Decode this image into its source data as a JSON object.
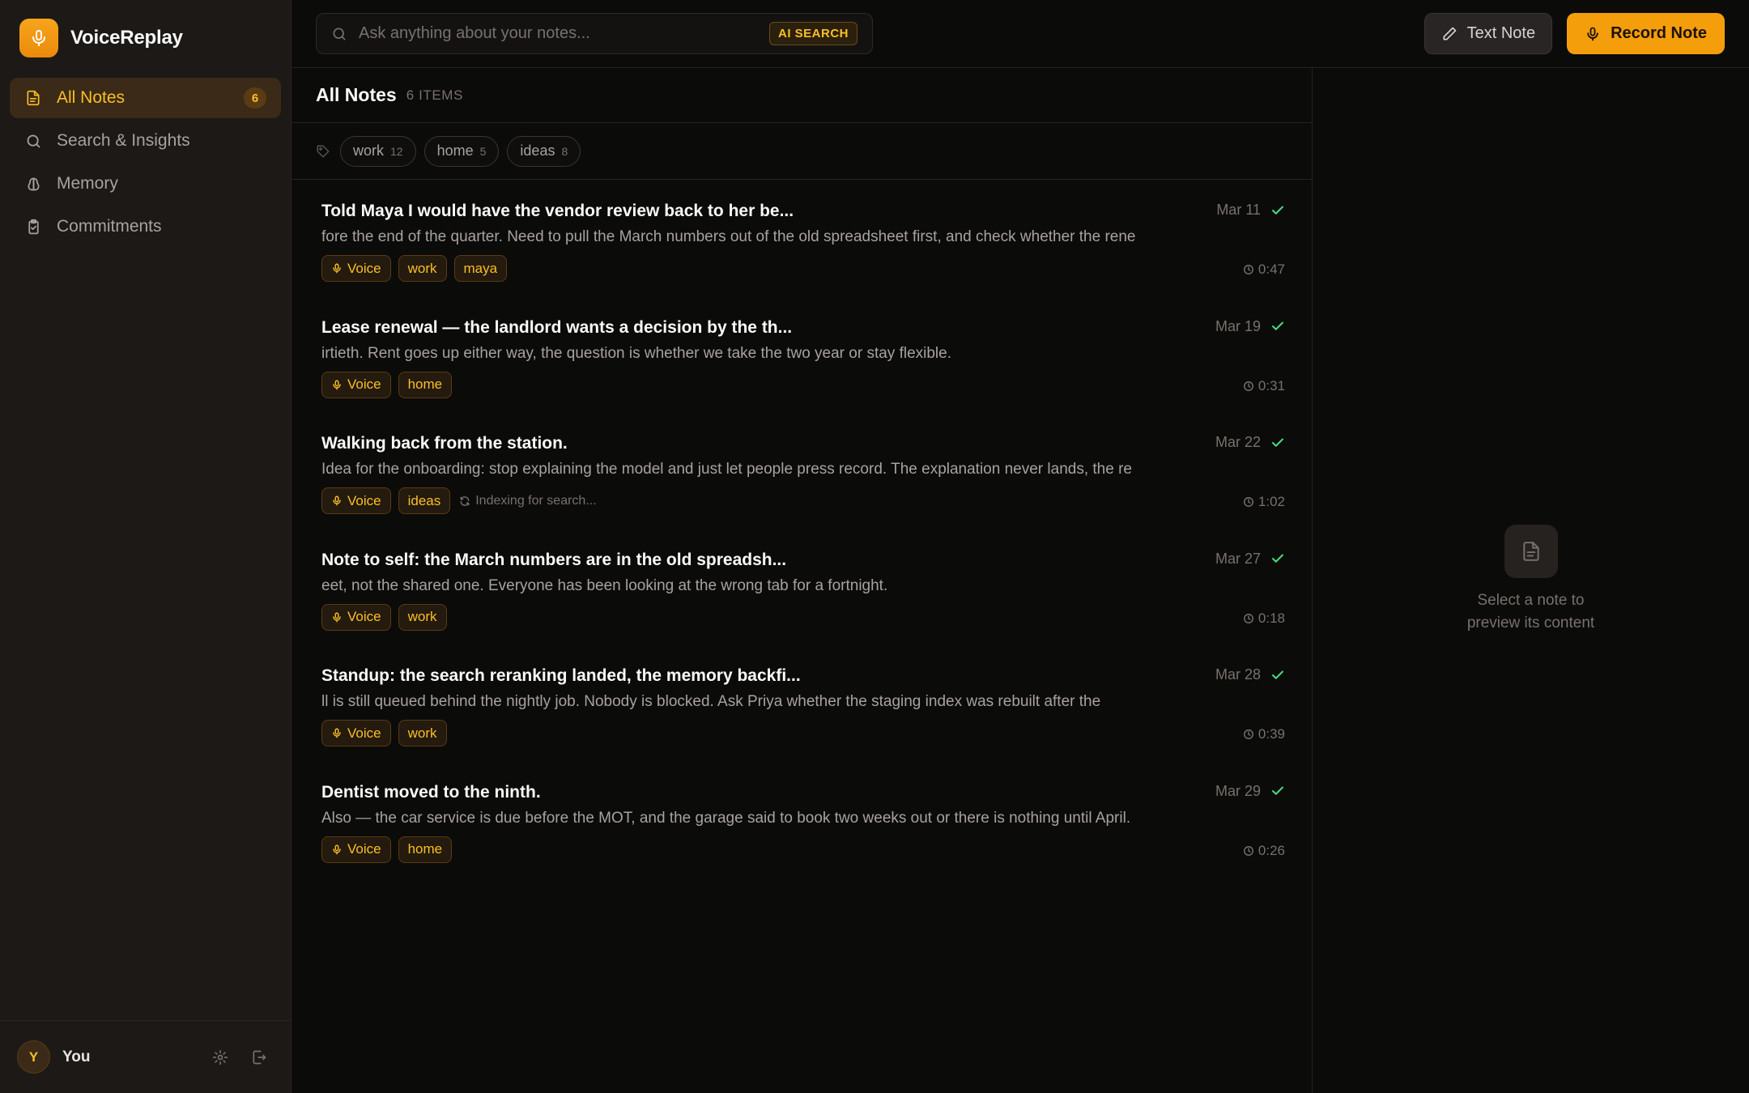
{
  "app": {
    "name": "VoiceReplay"
  },
  "sidebar": {
    "items": [
      {
        "label": "All Notes",
        "count": "6",
        "icon": "file-text-icon",
        "active": true
      },
      {
        "label": "Search & Insights",
        "icon": "search-icon"
      },
      {
        "label": "Memory",
        "icon": "brain-icon"
      },
      {
        "label": "Commitments",
        "icon": "clipboard-check-icon"
      }
    ],
    "user": {
      "initial": "Y",
      "name": "You"
    }
  },
  "search": {
    "placeholder": "Ask anything about your notes...",
    "badge": "AI SEARCH"
  },
  "toolbar": {
    "text_note_label": "Text Note",
    "record_note_label": "Record Note"
  },
  "list": {
    "title": "All Notes",
    "count": "6 ITEMS",
    "filters": [
      {
        "label": "work",
        "count": "12"
      },
      {
        "label": "home",
        "count": "5"
      },
      {
        "label": "ideas",
        "count": "8"
      }
    ],
    "notes": [
      {
        "title": "Told Maya I would have the vendor review back to her be...",
        "excerpt": "fore the end of the quarter. Need to pull the March numbers out of the old spreadsheet first, and check whether the rene",
        "date": "Mar 11",
        "duration": "0:47",
        "type": "Voice",
        "tags": [
          "work",
          "maya"
        ]
      },
      {
        "title": "Lease renewal — the landlord wants a decision by the th...",
        "excerpt": "irtieth. Rent goes up either way, the question is whether we take the two year or stay flexible.",
        "date": "Mar 19",
        "duration": "0:31",
        "type": "Voice",
        "tags": [
          "home"
        ]
      },
      {
        "title": "Walking back from the station.",
        "excerpt": "Idea for the onboarding: stop explaining the model and just let people press record. The explanation never lands, the re",
        "date": "Mar 22",
        "duration": "1:02",
        "type": "Voice",
        "tags": [
          "ideas"
        ],
        "status": "Indexing for search..."
      },
      {
        "title": "Note to self: the March numbers are in the old spreadsh...",
        "excerpt": "eet, not the shared one. Everyone has been looking at the wrong tab for a fortnight.",
        "date": "Mar 27",
        "duration": "0:18",
        "type": "Voice",
        "tags": [
          "work"
        ]
      },
      {
        "title": "Standup: the search reranking landed, the memory backfi...",
        "excerpt": "ll is still queued behind the nightly job. Nobody is blocked. Ask Priya whether the staging index was rebuilt after the",
        "date": "Mar 28",
        "duration": "0:39",
        "type": "Voice",
        "tags": [
          "work"
        ]
      },
      {
        "title": "Dentist moved to the ninth.",
        "excerpt": "Also — the car service is due before the MOT, and the garage said to book two weeks out or there is nothing until April.",
        "date": "Mar 29",
        "duration": "0:26",
        "type": "Voice",
        "tags": [
          "home"
        ]
      }
    ]
  },
  "preview": {
    "empty_text": "Select a note to preview its content"
  },
  "colors": {
    "accent": "#f59e0b",
    "accent_text": "#fbbf24",
    "success": "#4ade80",
    "background": "#0b0b0a",
    "sidebar": "#1c1917"
  }
}
